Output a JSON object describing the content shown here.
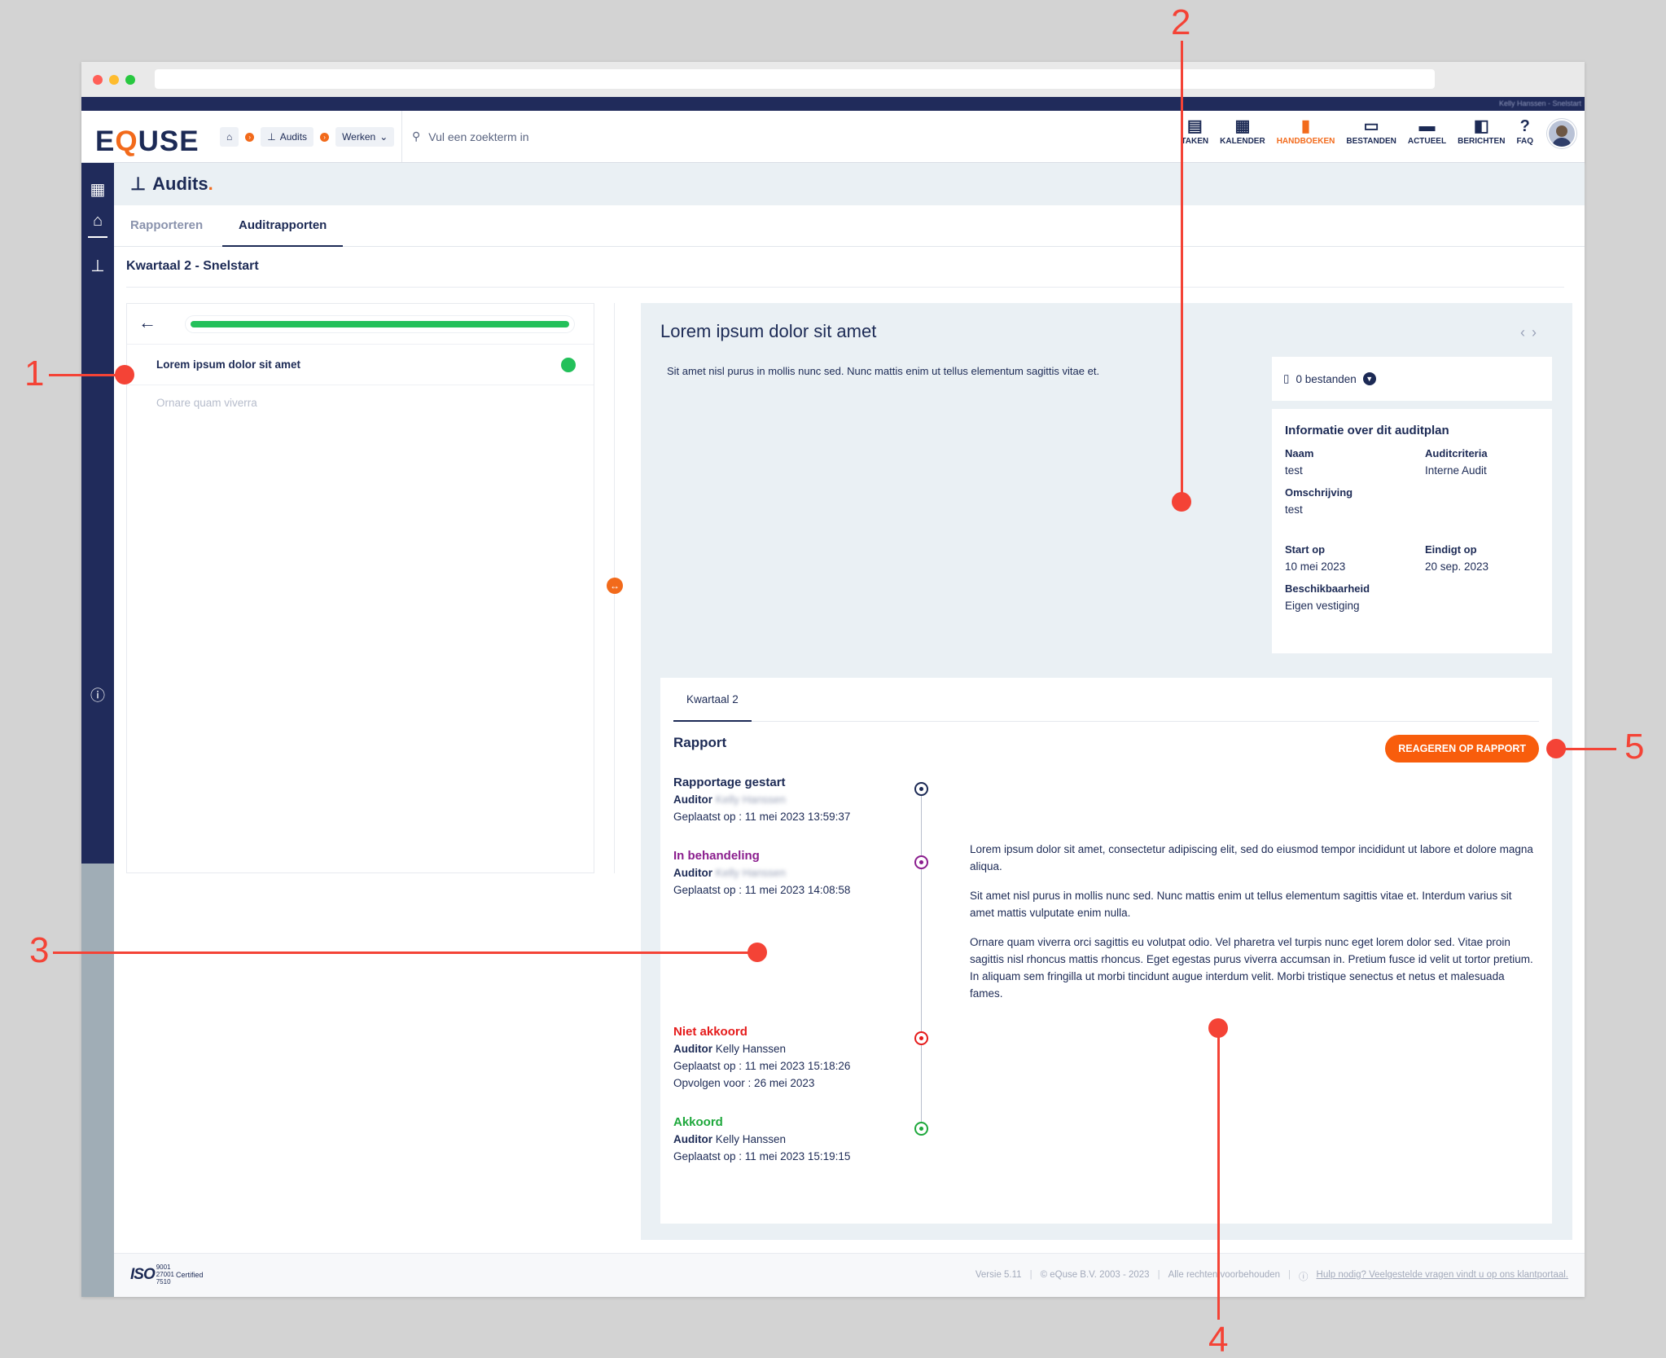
{
  "topstrip": {
    "user": "Kelly Hanssen - Snelstart"
  },
  "header": {
    "logo": {
      "part1": "E",
      "part2": "Q",
      "part3": "USE"
    },
    "breadcrumb": {
      "audits": "Audits",
      "werken": "Werken"
    },
    "search_placeholder": "Vul een zoekterm in",
    "nav": [
      {
        "label": "TAKEN",
        "icon": "clipboard-icon"
      },
      {
        "label": "KALENDER",
        "icon": "calendar-icon"
      },
      {
        "label": "HANDBOEKEN",
        "icon": "book-icon",
        "active": true
      },
      {
        "label": "BESTANDEN",
        "icon": "archive-icon"
      },
      {
        "label": "ACTUEEL",
        "icon": "newspaper-icon"
      },
      {
        "label": "BERICHTEN",
        "icon": "chat-icon"
      },
      {
        "label": "FAQ",
        "icon": "question-icon"
      }
    ]
  },
  "page": {
    "title": "Audits",
    "title_dot": ".",
    "tabs": [
      "Rapporteren",
      "Auditrapporten"
    ],
    "subtitle": "Kwartaal 2 - Snelstart"
  },
  "left": {
    "progress": 1.0,
    "items": [
      {
        "label": "Lorem ipsum dolor sit amet",
        "status": "done"
      },
      {
        "label": "Ornare quam viverra"
      }
    ]
  },
  "right": {
    "title": "Lorem ipsum dolor sit amet",
    "description": "Sit amet nisl purus in mollis nunc sed. Nunc mattis enim ut tellus elementum sagittis vitae et.",
    "files": "0 bestanden",
    "info": {
      "title": "Informatie over dit auditplan",
      "naam_k": "Naam",
      "naam_v": "test",
      "criteria_k": "Auditcriteria",
      "criteria_v": "Interne Audit",
      "omschrijving_k": "Omschrijving",
      "omschrijving_v": "test",
      "start_k": "Start op",
      "start_v": "10 mei 2023",
      "eind_k": "Eindigt op",
      "eind_v": "20 sep. 2023",
      "beschik_k": "Beschikbaarheid",
      "beschik_v": "Eigen vestiging"
    },
    "report": {
      "tab": "Kwartaal 2",
      "title": "Rapport",
      "button": "REAGEREN OP RAPPORT",
      "timeline": [
        {
          "status": "Rapportage gestart",
          "color": "#1c2a55",
          "auditor_k": "Auditor",
          "auditor_v": "Kelly Hanssen",
          "placed": "Geplaatst op : 11 mei 2023 13:59:37"
        },
        {
          "status": "In behandeling",
          "color": "#8b1e8e",
          "auditor_k": "Auditor",
          "auditor_v": "Kelly Hanssen",
          "placed": "Geplaatst op : 11 mei 2023 14:08:58"
        },
        {
          "status": "Niet akkoord",
          "color": "#e51b1b",
          "auditor_k": "Auditor",
          "auditor_v": "Kelly Hanssen",
          "placed": "Geplaatst op : 11 mei 2023 15:18:26",
          "follow": "Opvolgen voor : 26 mei 2023"
        },
        {
          "status": "Akkoord",
          "color": "#1ea83c",
          "auditor_k": "Auditor",
          "auditor_v": "Kelly Hanssen",
          "placed": "Geplaatst op : 11 mei 2023 15:19:15"
        }
      ],
      "comment": [
        "Lorem ipsum dolor sit amet, consectetur adipiscing elit, sed do eiusmod tempor incididunt ut labore et dolore magna aliqua.",
        "Sit amet nisl purus in mollis nunc sed. Nunc mattis enim ut tellus elementum sagittis vitae et. Interdum varius sit amet mattis vulputate enim nulla.",
        "Ornare quam viverra orci sagittis eu volutpat odio. Vel pharetra vel turpis nunc eget lorem dolor sed. Vitae proin sagittis nisl rhoncus mattis rhoncus. Eget egestas purus viverra accumsan in. Pretium fusce id velit ut tortor pretium. In aliquam sem fringilla ut morbi tincidunt augue interdum velit. Morbi tristique senectus et netus et malesuada fames."
      ]
    }
  },
  "footer": {
    "iso_word": "ISO",
    "iso_nums": [
      "9001",
      "27001",
      "7510"
    ],
    "iso_cert": "Certified",
    "version": "Versie 5.11",
    "copyright": "© eQuse B.V. 2003 - 2023",
    "rights": "Alle rechten voorbehouden",
    "help": "Hulp nodig? Veelgestelde vragen vindt u op ons klantportaal."
  },
  "annotations": [
    "1",
    "2",
    "3",
    "4",
    "5"
  ],
  "colors": {
    "brand_navy": "#202b5b",
    "accent_orange": "#f26a1b",
    "annotation_red": "#f44336",
    "success_green": "#23c05a"
  }
}
